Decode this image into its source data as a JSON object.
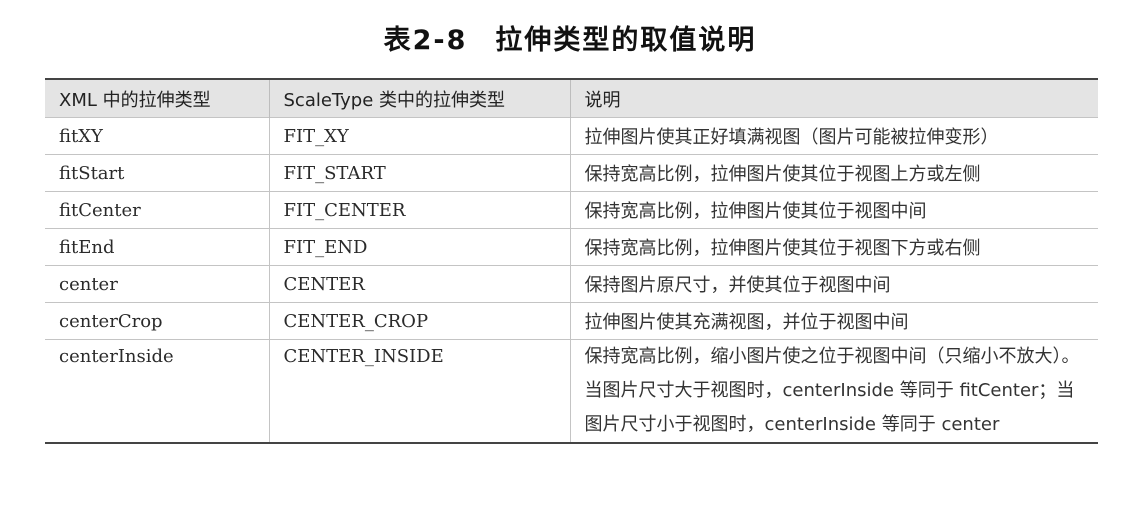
{
  "title": {
    "number": "表2-8",
    "text": "拉伸类型的取值说明"
  },
  "table": {
    "headers": [
      "XML 中的拉伸类型",
      "ScaleType 类中的拉伸类型",
      "说明"
    ],
    "rows": [
      [
        "fitXY",
        "FIT_XY",
        "拉伸图片使其正好填满视图（图片可能被拉伸变形）"
      ],
      [
        "fitStart",
        "FIT_START",
        "保持宽高比例，拉伸图片使其位于视图上方或左侧"
      ],
      [
        "fitCenter",
        "FIT_CENTER",
        "保持宽高比例，拉伸图片使其位于视图中间"
      ],
      [
        "fitEnd",
        "FIT_END",
        "保持宽高比例，拉伸图片使其位于视图下方或右侧"
      ],
      [
        "center",
        "CENTER",
        "保持图片原尺寸，并使其位于视图中间"
      ],
      [
        "centerCrop",
        "CENTER_CROP",
        "拉伸图片使其充满视图，并位于视图中间"
      ],
      [
        "centerInside",
        "CENTER_INSIDE",
        "保持宽高比例，缩小图片使之位于视图中间（只缩小不放大）。当图片尺寸大于视图时，centerInside 等同于 fitCenter；当图片尺寸小于视图时，centerInside 等同于 center"
      ]
    ]
  }
}
